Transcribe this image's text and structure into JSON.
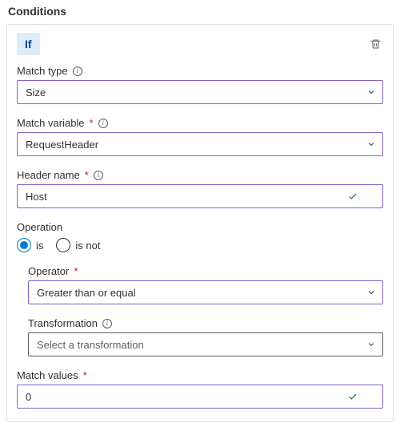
{
  "title": "Conditions",
  "ifLabel": "If",
  "matchType": {
    "label": "Match type",
    "value": "Size"
  },
  "matchVariable": {
    "label": "Match variable",
    "value": "RequestHeader"
  },
  "headerName": {
    "label": "Header name",
    "value": "Host"
  },
  "operation": {
    "label": "Operation",
    "options": {
      "is": "is",
      "isNot": "is not"
    },
    "selected": "is"
  },
  "operator": {
    "label": "Operator",
    "value": "Greater than or equal"
  },
  "transformation": {
    "label": "Transformation",
    "placeholder": "Select a transformation"
  },
  "matchValues": {
    "label": "Match values",
    "value": "0"
  }
}
